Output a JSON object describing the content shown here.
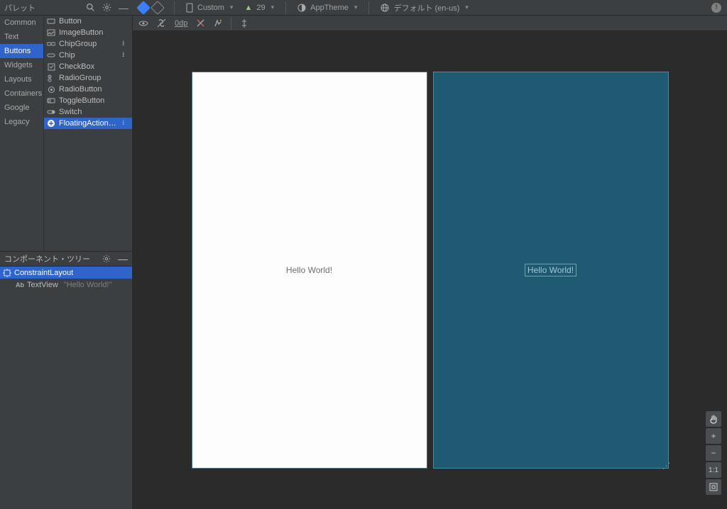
{
  "topbar": {
    "palette_title": "パレット",
    "device_label": "Custom",
    "api_level": "29",
    "theme_label": "AppTheme",
    "locale_label": "デフォルト (en-us)"
  },
  "palette": {
    "categories": [
      {
        "label": "Common"
      },
      {
        "label": "Text"
      },
      {
        "label": "Buttons",
        "active": true
      },
      {
        "label": "Widgets"
      },
      {
        "label": "Layouts"
      },
      {
        "label": "Containers"
      },
      {
        "label": "Google"
      },
      {
        "label": "Legacy"
      }
    ],
    "components": [
      {
        "icon": "button",
        "label": "Button"
      },
      {
        "icon": "imagebutton",
        "label": "ImageButton"
      },
      {
        "icon": "chipgroup",
        "label": "ChipGroup",
        "download": true
      },
      {
        "icon": "chip",
        "label": "Chip",
        "download": true
      },
      {
        "icon": "checkbox",
        "label": "CheckBox"
      },
      {
        "icon": "radiogroup",
        "label": "RadioGroup"
      },
      {
        "icon": "radiobutton",
        "label": "RadioButton"
      },
      {
        "icon": "togglebutton",
        "label": "ToggleButton"
      },
      {
        "icon": "switch",
        "label": "Switch"
      },
      {
        "icon": "fab",
        "label": "FloatingActionB...",
        "download": true,
        "active": true
      }
    ]
  },
  "component_tree": {
    "title": "コンポーネント・ツリー",
    "root": {
      "label": "ConstraintLayout"
    },
    "child": {
      "label": "TextView",
      "hint": "\"Hello World!\""
    }
  },
  "canvas_toolbar": {
    "margin": "0dp"
  },
  "preview": {
    "text": "Hello World!"
  },
  "zoom": {
    "reset": "1:1"
  }
}
